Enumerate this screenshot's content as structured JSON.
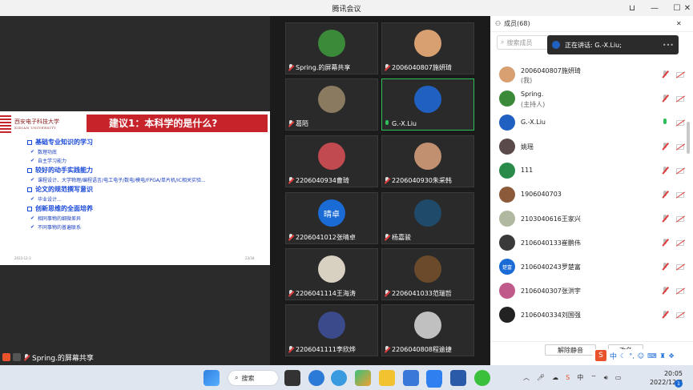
{
  "window": {
    "title": "腾讯会议"
  },
  "share": {
    "sharer_label": "Spring.的屏幕共享",
    "slide": {
      "logo": "西安电子科技大学",
      "logo_en": "XIDIAN UNIVERSITY",
      "title": "建议1：本科学的是什么?",
      "bullets": [
        {
          "text": "基础专业知识的学习",
          "subs": [
            "数理功底",
            "自主学习能力"
          ]
        },
        {
          "text": "较好的动手实践能力",
          "subs": [
            "课程设计、大学物理/编程语言/电工电子/数电/模电/FPGA/单片机/IC相关实验..."
          ]
        },
        {
          "text": "论文的规范撰写意识",
          "subs": [
            "毕业设计..."
          ]
        },
        {
          "text": "创新思维的全面培养",
          "subs": [
            "相同事物的细微差异",
            "不同事物的普遍联系"
          ]
        }
      ],
      "footer_left": "2022-12-3",
      "footer_right": "23/34"
    }
  },
  "tiles": [
    {
      "name": "Spring.的屏幕共享",
      "avatar_color": "#3a8a3a"
    },
    {
      "name": "2006040807施妍琦",
      "avatar_color": "#d8a070"
    },
    {
      "name": "葛陌",
      "avatar_color": "#8a7a60"
    },
    {
      "name": "G.-X.Liu",
      "avatar_color": "#2060c0"
    },
    {
      "name": "2206040934曹琦",
      "avatar_color": "#c04a50"
    },
    {
      "name": "2206040930朱采韩",
      "avatar_color": "#c09070"
    },
    {
      "name": "2206041012张晴卓",
      "avatar_color": "#1a6bd6",
      "avatar_text": "晴卓"
    },
    {
      "name": "杨嘉骏",
      "avatar_color": "#204a6a"
    },
    {
      "name": "2206041114王海涛",
      "avatar_color": "#d8d0c0"
    },
    {
      "name": "2206041033范瑞哲",
      "avatar_color": "#6a4a2a"
    },
    {
      "name": "2206041111李欣烨",
      "avatar_color": "#3a4a8a"
    },
    {
      "name": "2206040808程逾捷",
      "avatar_color": "#c0c0c0"
    }
  ],
  "panel": {
    "title": "成员(68)",
    "search_placeholder": "搜索成员",
    "speaking": "正在讲话: G.-X.Liu;",
    "members": [
      {
        "name": "2006040807施妍琦",
        "role": "(我)",
        "avatar_color": "#d8a070",
        "mic": "off"
      },
      {
        "name": "Spring.",
        "role": "(主持人)",
        "avatar_color": "#3a8a3a",
        "mic": "off"
      },
      {
        "name": "G.-X.Liu",
        "role": "",
        "avatar_color": "#2060c0",
        "mic": "on"
      },
      {
        "name": "姚瑶",
        "role": "",
        "avatar_color": "#5a4a4a",
        "mic": "off"
      },
      {
        "name": "111",
        "role": "",
        "avatar_color": "#2a8a4a",
        "mic": "off"
      },
      {
        "name": "1906040703",
        "role": "",
        "avatar_color": "#8a5a3a",
        "mic": "off"
      },
      {
        "name": "2103040616王家兴",
        "role": "",
        "avatar_color": "#b0b8a0",
        "mic": "off"
      },
      {
        "name": "2106040133崔鹏伟",
        "role": "",
        "avatar_color": "#3a3a3a",
        "mic": "off"
      },
      {
        "name": "2106040243罗楚富",
        "role": "",
        "avatar_color": "#1a6bd6",
        "avatar_text": "楚富",
        "mic": "off"
      },
      {
        "name": "2106040307张洪宇",
        "role": "",
        "avatar_color": "#c05a8a",
        "mic": "off"
      },
      {
        "name": "2106040334刘国强",
        "role": "",
        "avatar_color": "#222222",
        "mic": "off"
      }
    ],
    "unmute_all": "解除静音",
    "rename": "改名"
  },
  "ime": {
    "mode": "中"
  },
  "taskbar": {
    "search": "搜索",
    "time": "20:05",
    "date": "2022/12/3",
    "notifications": "1"
  }
}
